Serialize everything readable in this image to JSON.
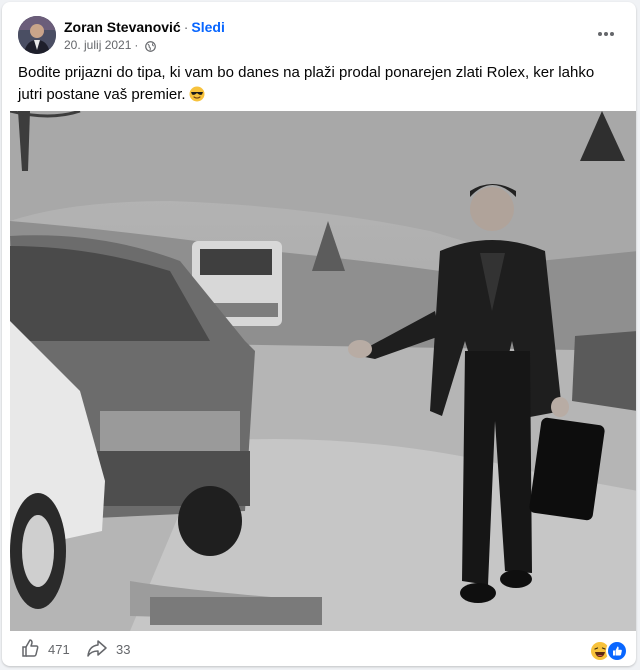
{
  "post": {
    "author": "Zoran Stevanović",
    "separator": "·",
    "follow_label": "Sledi",
    "date": "20. julij 2021",
    "date_separator": "·",
    "privacy_icon": "globe-icon",
    "more_icon": "more-options-icon",
    "text": "Bodite prijazni do tipa, ki vam bo danes na plaži prodal ponarejen zlati Rolex, ker lahko jutri postane vaš premier.",
    "emoji_icon": "sunglasses-emoji-icon"
  },
  "photo": {
    "description_icon": "post-photo"
  },
  "footer": {
    "like_count": "471",
    "share_count": "33",
    "like_icon": "thumbs-up-icon",
    "share_icon": "share-arrow-icon",
    "reactions": [
      "laughing-face-icon",
      "like-reaction-icon"
    ],
    "colors": {
      "link": "#0866ff",
      "muted": "#65676b"
    }
  }
}
